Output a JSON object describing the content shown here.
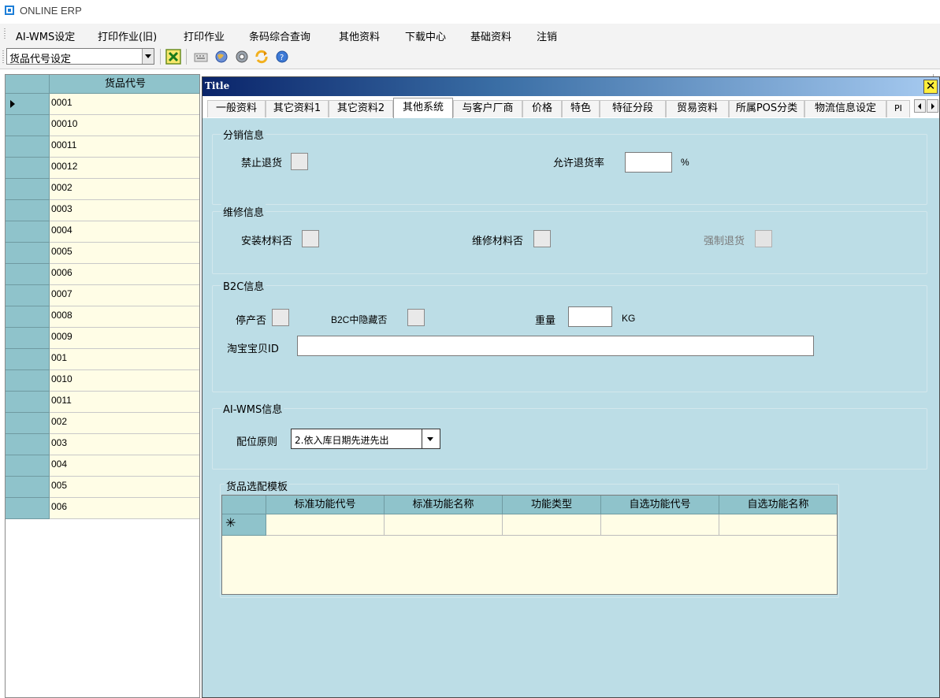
{
  "app": {
    "title": "ONLINE ERP"
  },
  "menubar": {
    "items": [
      "AI-WMS设定",
      "打印作业(旧)",
      "打印作业",
      "条码综合查询",
      "其他资料",
      "下载中心",
      "基础资料",
      "注销"
    ]
  },
  "toolbar": {
    "combo_value": "货品代号设定",
    "buttons": [
      "close-icon",
      "keyboard-icon",
      "globe-icon",
      "disc-icon",
      "refresh-icon",
      "help-icon"
    ]
  },
  "left_grid": {
    "header": "货品代号",
    "rows": [
      "0001",
      "00010",
      "00011",
      "00012",
      "0002",
      "0003",
      "0004",
      "0005",
      "0006",
      "0007",
      "0008",
      "0009",
      "001",
      "0010",
      "0011",
      "002",
      "003",
      "004",
      "005",
      "006"
    ]
  },
  "dialog": {
    "title": "Title",
    "tabs": [
      "一般资料",
      "其它资料1",
      "其它资料2",
      "其他系统",
      "与客户厂商",
      "价格",
      "特色",
      "特征分段",
      "贸易资料",
      "所属POS分类",
      "物流信息设定",
      "PI"
    ],
    "active_tab": "其他系统",
    "distribution": {
      "title": "分销信息",
      "no_return_label": "禁止退货",
      "allow_return_rate_label": "允许退货率",
      "allow_return_rate_value": "",
      "percent_unit": "%"
    },
    "repair": {
      "title": "维修信息",
      "install_material_label": "安装材料否",
      "repair_material_label": "维修材料否",
      "force_return_label": "强制退货"
    },
    "b2c": {
      "title": "B2C信息",
      "discontinued_label": "停产否",
      "b2c_hidden_label": "B2C中隐藏否",
      "weight_label": "重量",
      "weight_value": "",
      "weight_unit": "KG",
      "taobao_id_label": "淘宝宝贝ID",
      "taobao_id_value": ""
    },
    "wms": {
      "title": "AI-WMS信息",
      "placement_label": "配位原则",
      "placement_value": "2.依入库日期先进先出"
    },
    "template": {
      "title": "货品选配模板",
      "columns": [
        "标准功能代号",
        "标准功能名称",
        "功能类型",
        "自选功能代号",
        "自选功能名称"
      ],
      "new_row_marker": "✳"
    }
  }
}
